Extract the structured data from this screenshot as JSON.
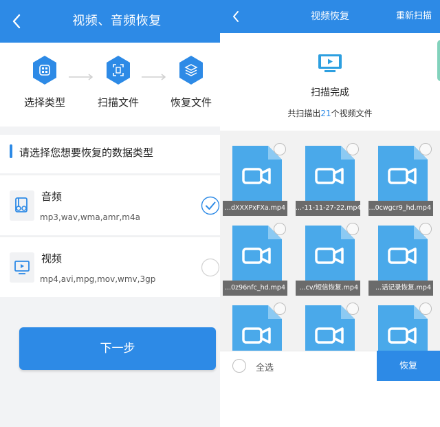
{
  "left": {
    "header": {
      "title": "视频、音频恢复",
      "back_icon": "chevron-left-icon"
    },
    "steps": [
      {
        "label": "选择类型",
        "icon": "grid-icon"
      },
      {
        "label": "扫描文件",
        "icon": "scan-icon"
      },
      {
        "label": "恢复文件",
        "icon": "layers-icon"
      }
    ],
    "section_title": "请选择您想要恢复的数据类型",
    "options": [
      {
        "name": "音频",
        "extensions": "mp3,wav,wma,amr,m4a",
        "icon": "audio-file-icon",
        "checked": true
      },
      {
        "name": "视频",
        "extensions": "mp4,avi,mpg,mov,wmv,3gp",
        "icon": "video-screen-icon",
        "checked": false
      }
    ],
    "next_button": "下一步"
  },
  "right": {
    "header": {
      "title": "视频恢复",
      "rescan": "重新扫描",
      "back_icon": "chevron-left-icon"
    },
    "summary": {
      "icon": "tv-play-icon",
      "status": "扫描完成",
      "count_prefix": "共扫描出",
      "count": "21",
      "count_suffix": "个视频文件"
    },
    "files": [
      {
        "name": "...dXXXPxFXa.mp4"
      },
      {
        "name": "...-11-11-27-22.mp4"
      },
      {
        "name": "...0cwgcr9_hd.mp4"
      },
      {
        "name": "...0z96nfc_hd.mp4"
      },
      {
        "name": "...cv/短信恢复.mp4"
      },
      {
        "name": "...话记录恢复.mp4"
      },
      {
        "name": ""
      },
      {
        "name": ""
      },
      {
        "name": ""
      }
    ],
    "bottom": {
      "select_all": "全选",
      "recover": "恢复"
    }
  },
  "colors": {
    "primary": "#2d8ae6",
    "tile_blue": "#4aa9ea",
    "caption_bg": "#6b6b6b"
  }
}
